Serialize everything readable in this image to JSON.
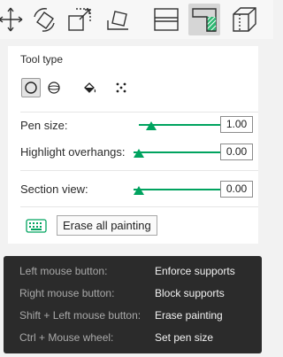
{
  "toolbar": {
    "tools": [
      {
        "icon": "move-icon"
      },
      {
        "icon": "rotate-icon"
      },
      {
        "icon": "scale-icon"
      },
      {
        "icon": "lay-on-face-icon"
      },
      {
        "icon": "cut-icon"
      },
      {
        "icon": "support-painting-icon",
        "selected": true
      },
      {
        "icon": "seam-painting-icon"
      }
    ]
  },
  "panel": {
    "tool_type_label": "Tool type",
    "tools": [
      {
        "icon": "circle-brush-icon",
        "active": true
      },
      {
        "icon": "sphere-brush-icon",
        "active": false
      },
      {
        "icon": "fill-bucket-icon",
        "active": false
      },
      {
        "icon": "gap-fill-icon",
        "active": false
      }
    ],
    "pen_size": {
      "label": "Pen size:",
      "value": "1.00",
      "fraction": 0.08
    },
    "highlight_overhangs": {
      "label": "Highlight overhangs:",
      "value": "0.00",
      "fraction": 0.0
    },
    "section_view": {
      "label": "Section view:",
      "value": "0.00",
      "fraction": 0.0
    },
    "keyboard_icon": "keyboard-icon",
    "erase_all_label": "Erase all painting"
  },
  "shortcuts": [
    {
      "key": "Left mouse button:",
      "action": "Enforce supports"
    },
    {
      "key": "Right mouse button:",
      "action": "Block supports"
    },
    {
      "key": "Shift + Left mouse button:",
      "action": "Erase painting"
    },
    {
      "key": "Ctrl + Mouse wheel:",
      "action": "Set pen size"
    }
  ],
  "colors": {
    "accent": "#00a35f",
    "tooltip_bg": "#2b2b2b"
  }
}
